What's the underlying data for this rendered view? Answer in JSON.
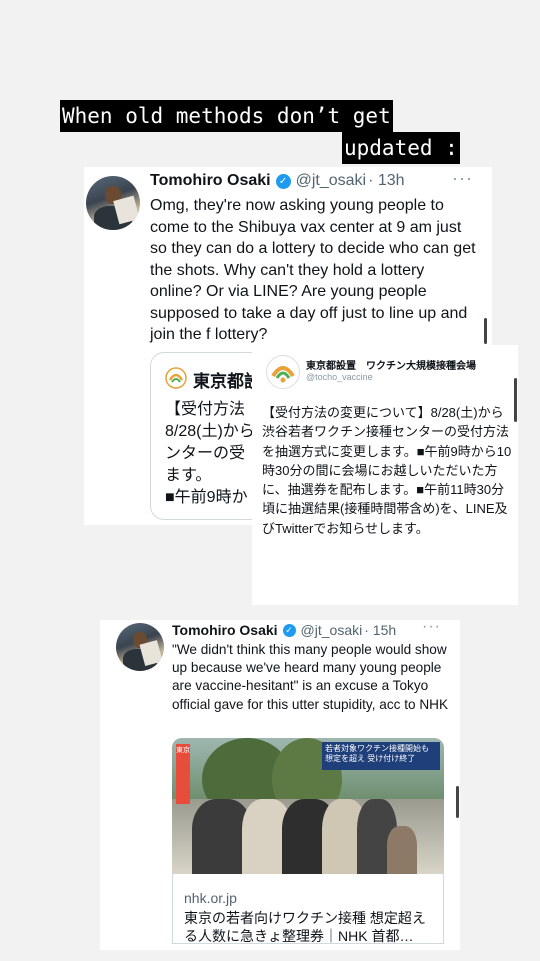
{
  "caption": {
    "line1": "When old methods don’t get",
    "line2": "updated :"
  },
  "tweet1": {
    "name": "Tomohiro Osaki",
    "handle": "@jt_osaki",
    "time": "· 13h",
    "more": "···",
    "text": "Omg, they're now asking young people to come to the Shibuya vax center at 9 am just so they can do a lottery to decide who can get the shots. Why can't they hold a lottery online? Or via LINE? Are young people supposed to take a day off just to line up and join the f lottery?",
    "quote": {
      "title": "東京都設",
      "text": "【受付方法\n8/28(土)から\nンターの受\nます。\n■午前9時か"
    }
  },
  "overlay": {
    "title": "東京都設置　ワクチン大規模接種会場",
    "handle": "@tocho_vaccine",
    "text": "【受付方法の変更について】8/28(土)から渋谷若者ワクチン接種センターの受付方法を抽選方式に変更します。■午前9時から10時30分の間に会場にお越しいただいた方に、抽選券を配布します。■午前11時30分頃に抽選結果(接種時間帯含め)を、LINE及びTwitterでお知らせします。"
  },
  "tweet2": {
    "name": "Tomohiro Osaki",
    "handle": "@jt_osaki",
    "time": "· 15h",
    "more": "···",
    "text": "\"We didn't think this many people would show up because we've heard many young people are vaccine-hesitant\" is an excuse a Tokyo official gave for this utter stupidity, acc to NHK",
    "media": {
      "banner": "若者対象ワクチン接種開始も 想定を超え 受け付け終了",
      "badge": "東京"
    },
    "link": {
      "domain": "nhk.or.jp",
      "title": "東京の若者向けワクチン接種 想定超える人数に急きょ整理券｜NHK 首都…"
    }
  }
}
